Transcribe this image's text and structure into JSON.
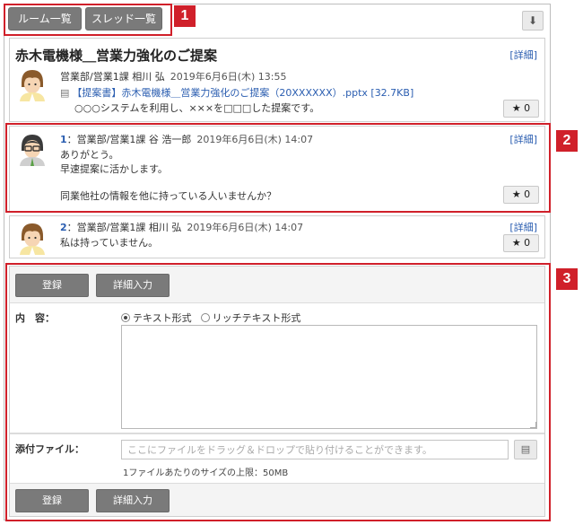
{
  "toolbar": {
    "rooms_label": "ルーム一覧",
    "threads_label": "スレッド一覧",
    "download_icon": "download-arrow-icon"
  },
  "callouts": [
    "1",
    "2",
    "3"
  ],
  "thread": {
    "title": "赤木電機様＿営業力強化のご提案",
    "detail_label": "[詳細]",
    "author": "営業部/営業1課 相川 弘",
    "date": "2019年6月6日(木) 13:55",
    "attachment": "【提案書】赤木電機様＿営業力強化のご提案（20XXXXXX）.pptx [32.7KB]",
    "body": "○○○システムを利用し、×××を□□□した提案です。",
    "star": "★ 0"
  },
  "replies": [
    {
      "number": "1",
      "author": "：営業部/営業1課 谷 浩一郎",
      "date": "2019年6月6日(木) 14:07",
      "detail_label": "[詳細]",
      "lines": [
        "ありがとう。",
        "早速提案に活かします。",
        "同業他社の情報を他に持っている人いませんか？"
      ],
      "star": "★ 0"
    },
    {
      "number": "2",
      "author": "：営業部/営業1課 相川 弘",
      "date": "2019年6月6日(木) 14:07",
      "detail_label": "[詳細]",
      "lines": [
        "私は持っていません。"
      ],
      "star": "★ 0"
    }
  ],
  "form": {
    "register_label": "登録",
    "detail_input_label": "詳細入力",
    "content_label": "内　容：",
    "radio_text": "テキスト形式",
    "radio_rich": "リッチテキスト形式",
    "attach_label": "添付ファイル：",
    "drop_placeholder": "ここにファイルをドラッグ＆ドロップで貼り付けることができます。",
    "size_note": "1ファイルあたりのサイズの上限：50MB"
  },
  "colors": {
    "accent_red": "#d0202a",
    "link_blue": "#2a5db0",
    "button_gray": "#7a7a7a"
  }
}
